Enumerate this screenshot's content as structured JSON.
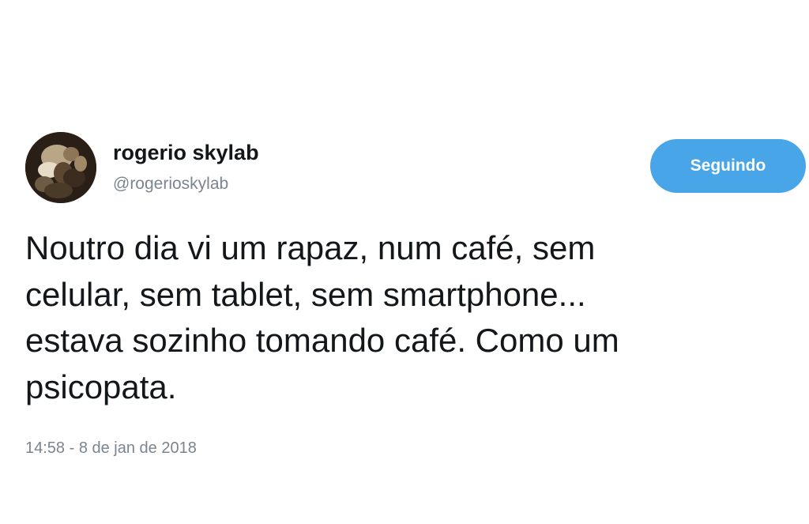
{
  "tweet": {
    "author": {
      "display_name": "rogerio skylab",
      "handle": "@rogerioskylab"
    },
    "follow_button_label": "Seguindo",
    "text_lines": [
      "Noutro dia vi um rapaz, num café, sem",
      "celular, sem tablet, sem smartphone...",
      "estava sozinho tomando café. Como um",
      "psicopata."
    ],
    "timestamp": "14:58 - 8 de jan de 2018"
  },
  "colors": {
    "accent": "#48a5e7",
    "text": "#14171a",
    "muted": "#7b858f"
  }
}
